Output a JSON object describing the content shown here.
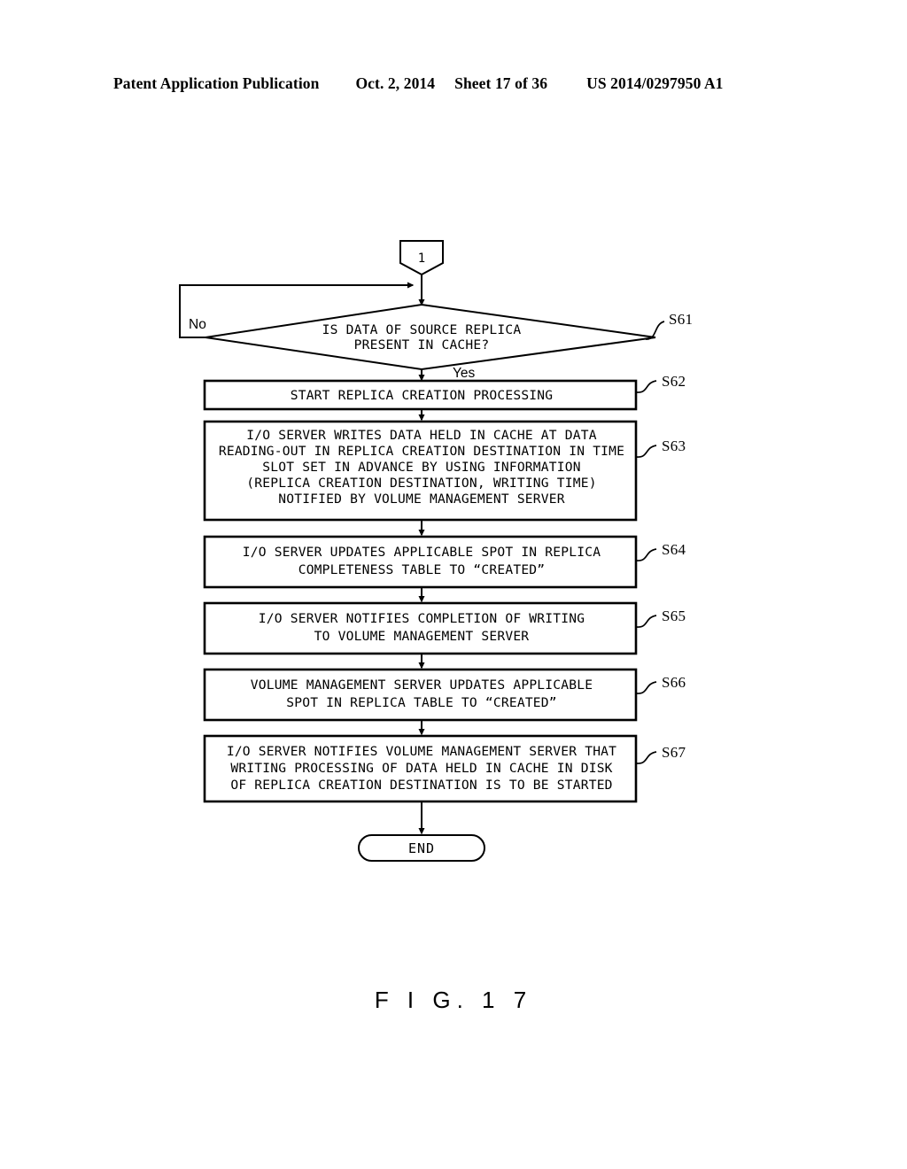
{
  "header": {
    "publication": "Patent Application Publication",
    "date": "Oct. 2, 2014",
    "sheet": "Sheet 17 of 36",
    "number": "US 2014/0297950 A1"
  },
  "figure": {
    "caption": "F I G. 1 7"
  },
  "flowchart": {
    "connector_in": {
      "label": "1",
      "name": "connector-1"
    },
    "decision": {
      "step": "S61",
      "line1": "IS DATA OF SOURCE REPLICA",
      "line2": "PRESENT IN CACHE?",
      "branch_no": "No",
      "branch_yes": "Yes"
    },
    "steps": [
      {
        "step": "S62",
        "lines": [
          "START REPLICA CREATION PROCESSING"
        ]
      },
      {
        "step": "S63",
        "lines": [
          "I/O SERVER WRITES DATA HELD IN CACHE AT DATA",
          "READING-OUT IN REPLICA CREATION DESTINATION IN TIME",
          "SLOT SET IN ADVANCE BY USING INFORMATION",
          "(REPLICA CREATION DESTINATION, WRITING TIME)",
          "NOTIFIED BY VOLUME MANAGEMENT SERVER"
        ]
      },
      {
        "step": "S64",
        "lines": [
          "I/O SERVER UPDATES APPLICABLE SPOT IN REPLICA",
          "COMPLETENESS TABLE TO  “CREATED”"
        ]
      },
      {
        "step": "S65",
        "lines": [
          "I/O SERVER NOTIFIES COMPLETION OF WRITING",
          "TO VOLUME MANAGEMENT SERVER"
        ]
      },
      {
        "step": "S66",
        "lines": [
          "VOLUME MANAGEMENT SERVER UPDATES APPLICABLE",
          "SPOT IN REPLICA TABLE TO  “CREATED”"
        ]
      },
      {
        "step": "S67",
        "lines": [
          "I/O SERVER NOTIFIES VOLUME MANAGEMENT SERVER THAT",
          "WRITING PROCESSING OF DATA HELD IN CACHE IN DISK",
          "OF REPLICA CREATION DESTINATION IS TO BE STARTED"
        ]
      }
    ],
    "terminal_end": {
      "label": "END"
    }
  },
  "colors": {
    "ink": "#000000",
    "paper": "#ffffff"
  }
}
